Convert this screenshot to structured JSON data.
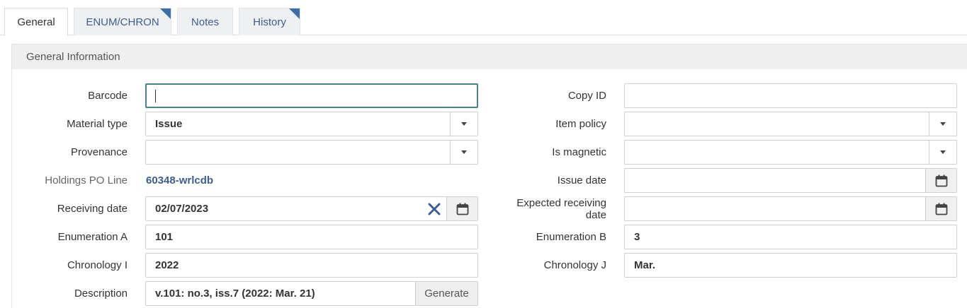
{
  "tabs": [
    {
      "label": "General",
      "active": true,
      "has_indicator": false
    },
    {
      "label": "ENUM/CHRON",
      "active": false,
      "has_indicator": true
    },
    {
      "label": "Notes",
      "active": false,
      "has_indicator": false
    },
    {
      "label": "History",
      "active": false,
      "has_indicator": true
    }
  ],
  "section": {
    "title": "General Information"
  },
  "left": {
    "barcode": {
      "label": "Barcode",
      "value": ""
    },
    "material_type": {
      "label": "Material type",
      "value": "Issue"
    },
    "provenance": {
      "label": "Provenance",
      "value": ""
    },
    "holdings_po_line": {
      "label": "Holdings PO Line",
      "value": "60348-wrlcdb"
    },
    "receiving_date": {
      "label": "Receiving date",
      "value": "02/07/2023"
    },
    "enumeration_a": {
      "label": "Enumeration A",
      "value": "101"
    },
    "chronology_i": {
      "label": "Chronology I",
      "value": "2022"
    },
    "description": {
      "label": "Description",
      "value": "v.101: no.3, iss.7 (2022: Mar. 21)",
      "generate_label": "Generate"
    }
  },
  "right": {
    "copy_id": {
      "label": "Copy ID",
      "value": ""
    },
    "item_policy": {
      "label": "Item policy",
      "value": ""
    },
    "is_magnetic": {
      "label": "Is magnetic",
      "value": ""
    },
    "issue_date": {
      "label": "Issue date",
      "value": ""
    },
    "expected_receiving_date": {
      "label_line1": "Expected receiving",
      "label_line2": "date",
      "value": ""
    },
    "enumeration_b": {
      "label": "Enumeration B",
      "value": "3"
    },
    "chronology_j": {
      "label": "Chronology J",
      "value": "Mar."
    }
  },
  "icons": {
    "calendar": "calendar-icon",
    "clear": "clear-icon",
    "dropdown": "chevron-down-icon"
  },
  "colors": {
    "link": "#3d5f8f",
    "tab_indicator": "#3b6fa6",
    "focus_border": "#4a7f8c"
  }
}
